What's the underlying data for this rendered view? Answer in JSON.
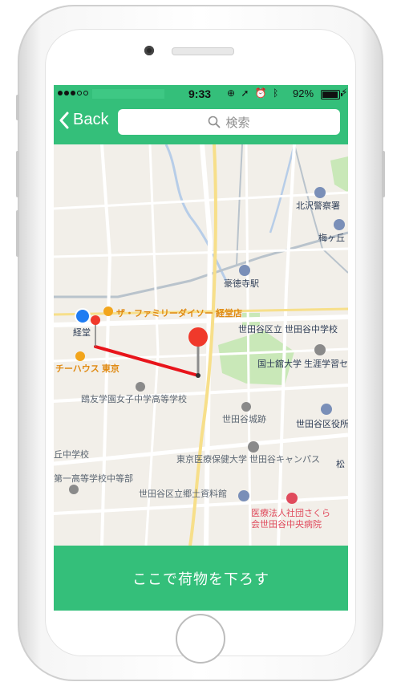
{
  "status_bar": {
    "time": "9:33",
    "battery_percent": "92%",
    "battery_level": 0.92,
    "icons": [
      "signal-dots-icon",
      "lock-rotation-icon",
      "location-arrow-icon",
      "alarm-icon",
      "bluetooth-icon",
      "battery-icon",
      "charging-bolt-icon"
    ]
  },
  "nav": {
    "back_label": "Back",
    "search_placeholder": "検索"
  },
  "map": {
    "labels": {
      "police": "北沢警察署",
      "umegaoka": "梅ヶ丘",
      "gotokuji": "豪徳寺駅",
      "daiso": "ザ・ファミリーダイソー 経堂店",
      "kyodo": "経堂",
      "ward_office_school": "世田谷区立 世田谷中学校",
      "kokushikan": "国士舘大学 生涯学習セ",
      "chihouse": "チーハウス 東京",
      "ohtomo": "鴎友学園女子中学高等学校",
      "setagaya_castle": "世田谷城跡",
      "ward_office": "世田谷区役所",
      "middle_school": "丘中学校",
      "tokyo_iryo": "東京医療保健大学 世田谷キャンパス",
      "matsu": "松",
      "daiichi": "第一高等学校中等部",
      "museum": "世田谷区立郷土資料館",
      "hospital_1": "医療法人社団さくら",
      "hospital_2": "会世田谷中央病院"
    }
  },
  "cta_label": "ここで荷物を下ろす",
  "colors": {
    "brand_green": "#34bf7a",
    "route_red": "#e8141b",
    "pin_red": "#f0392b",
    "user_dot_blue": "#1f7cf2"
  }
}
